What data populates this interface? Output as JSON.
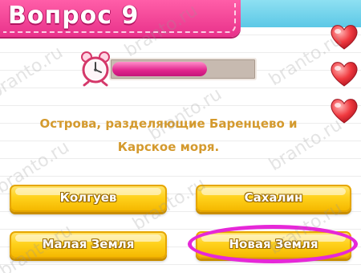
{
  "header": {
    "title": "Вопрос 9"
  },
  "timer": {
    "remaining_fraction": 0.67,
    "icon": "alarm-clock-icon"
  },
  "lives": {
    "count": 3,
    "icon": "heart-icon"
  },
  "question": {
    "line1": "Острова, разделяющие Баренцево и",
    "line2": "Карское моря."
  },
  "answers": [
    {
      "label": "Колгуев"
    },
    {
      "label": "Сахалин"
    },
    {
      "label": "Малая Земля"
    },
    {
      "label": "Новая Земля"
    }
  ],
  "highlight": {
    "answer_index": 3,
    "color": "#e628d8"
  },
  "watermark": {
    "text": "branto.ru"
  },
  "colors": {
    "header": "#e8318a",
    "top_stripe": "#5cc8e6",
    "question_text": "#d49a2e",
    "button": "#ffd21c",
    "timer_fill": "#e0248c"
  }
}
